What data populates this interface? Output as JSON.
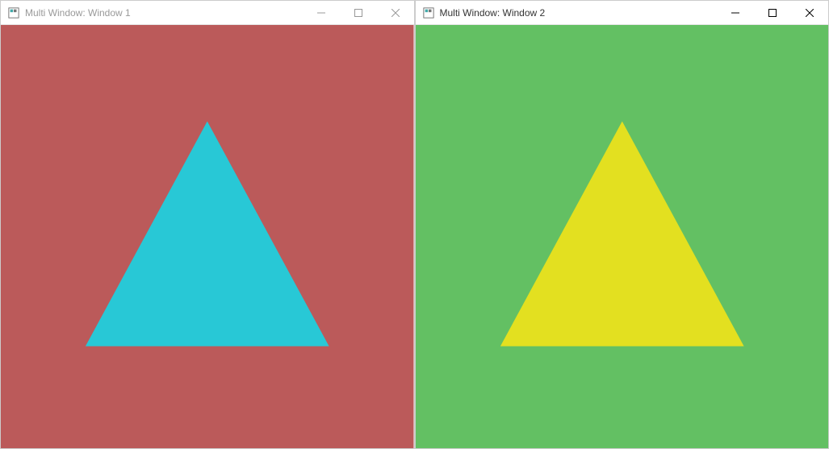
{
  "windows": [
    {
      "title": "Multi Window: Window 1",
      "active": false,
      "background_color": "#bb5a5a",
      "triangle_color": "#28c8d6"
    },
    {
      "title": "Multi Window: Window 2",
      "active": true,
      "background_color": "#63c063",
      "triangle_color": "#e3e020"
    }
  ]
}
